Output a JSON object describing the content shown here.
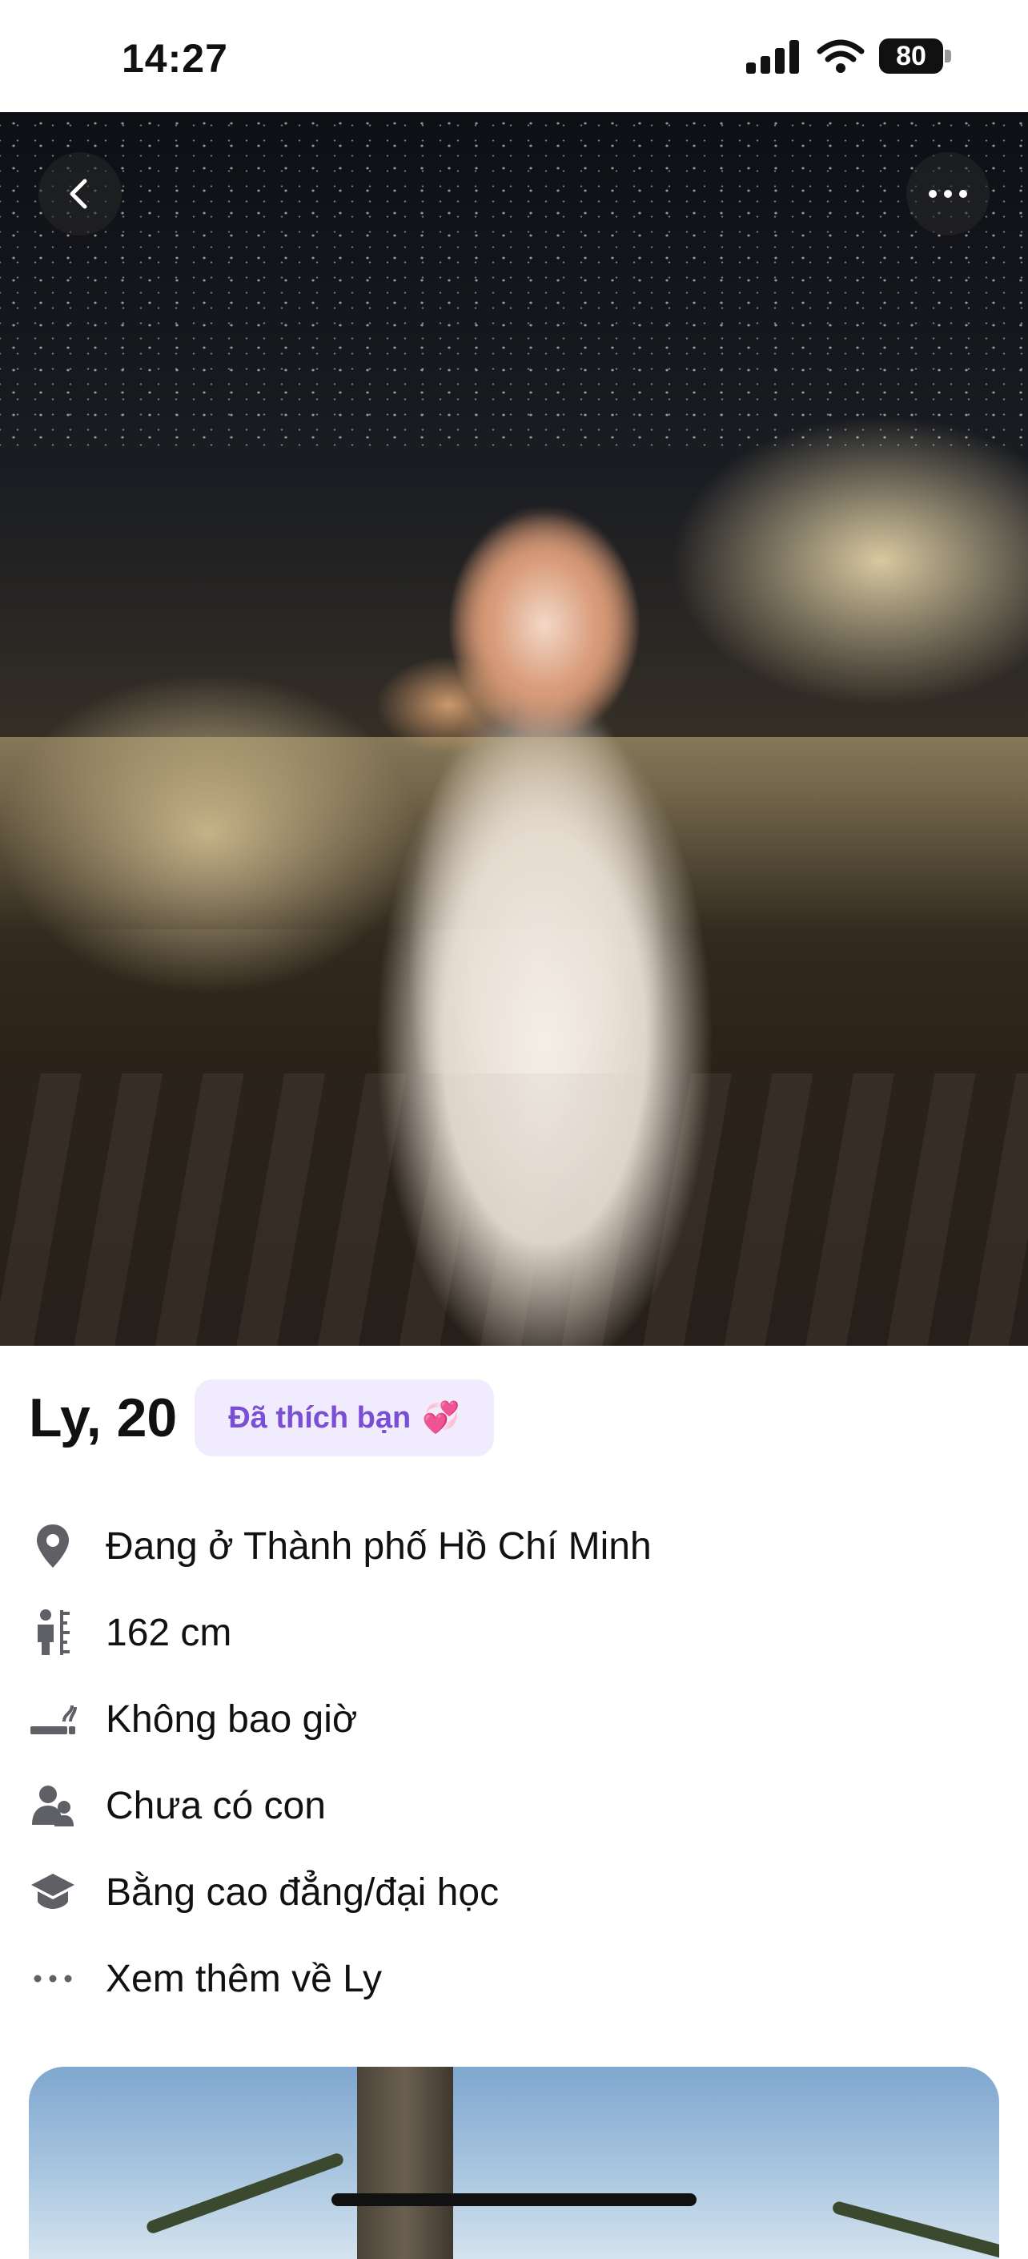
{
  "status_bar": {
    "time": "14:27",
    "battery": "80"
  },
  "profile": {
    "name_age": "Ly, 20",
    "liked_badge": "Đã thích bạn",
    "liked_emoji": "💞"
  },
  "info": [
    {
      "icon": "location-pin-icon",
      "text": "Đang ở Thành phố Hồ Chí Minh"
    },
    {
      "icon": "height-icon",
      "text": "162 cm"
    },
    {
      "icon": "smoking-icon",
      "text": "Không bao giờ"
    },
    {
      "icon": "children-icon",
      "text": "Chưa có con"
    },
    {
      "icon": "education-cap-icon",
      "text": "Bằng cao đẳng/đại học"
    },
    {
      "icon": "more-dots-icon",
      "text": "Xem thêm về Ly"
    }
  ],
  "colors": {
    "badge_bg": "#f1ecfd",
    "badge_text": "#7a4fd6",
    "icon_gray": "#5f5f66"
  }
}
